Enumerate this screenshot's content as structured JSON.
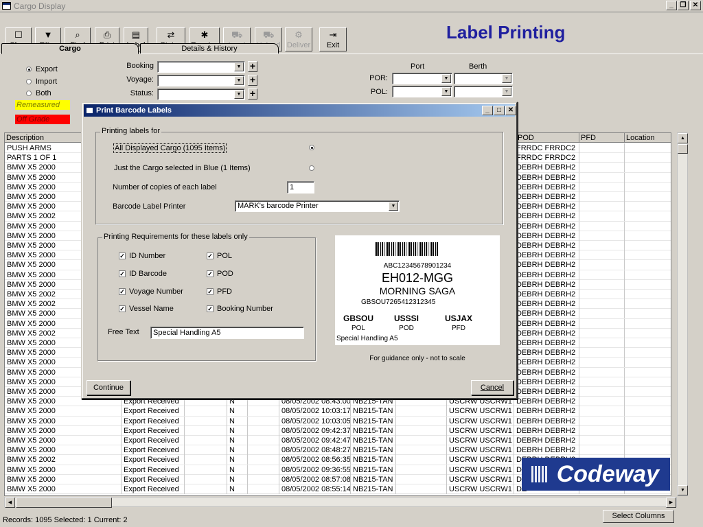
{
  "window": {
    "title": "Cargo Display"
  },
  "toolbar": [
    {
      "label": "Clear",
      "icon": "☐",
      "icon_name": "new-page-icon",
      "disabled": false
    },
    {
      "label": "Filter",
      "icon": "▼",
      "icon_name": "filter-funnel-icon",
      "disabled": false
    },
    {
      "label": "Find",
      "icon": "⌕",
      "icon_name": "magnifier-icon",
      "disabled": false
    },
    {
      "label": "Print",
      "icon": "⎙",
      "icon_name": "printer-icon",
      "disabled": false
    },
    {
      "label": "Label",
      "icon": "▤",
      "icon_name": "label-icon",
      "disabled": false
    },
    {
      "label": "Status",
      "icon": "⇄",
      "icon_name": "status-icon",
      "disabled": false
    },
    {
      "label": "Receive",
      "icon": "✱",
      "icon_name": "receive-icon",
      "disabled": false
    },
    {
      "label": "Load",
      "icon": "⛟",
      "icon_name": "load-icon",
      "disabled": true
    },
    {
      "label": "Unload",
      "icon": "⛟",
      "icon_name": "unload-icon",
      "disabled": true
    },
    {
      "label": "Deliver",
      "icon": "⚙",
      "icon_name": "deliver-icon",
      "disabled": true
    },
    {
      "label": "Exit",
      "icon": "⇥",
      "icon_name": "exit-door-icon",
      "disabled": false
    }
  ],
  "heading": "Label Printing",
  "tabs": [
    {
      "label": "Cargo"
    },
    {
      "label": "Details & History"
    }
  ],
  "filters": {
    "radios": [
      {
        "label": "Export",
        "checked": true
      },
      {
        "label": "Import",
        "checked": false
      },
      {
        "label": "Both",
        "checked": false
      }
    ],
    "booking_label": "Booking",
    "voyage_label": "Voyage:",
    "status_label": "Status:",
    "port_label": "Port",
    "berth_label": "Berth",
    "por_label": "POR:",
    "pol_label": "POL:",
    "tag_remeasured": "Remeasured",
    "tag_red": "Off Grade"
  },
  "grid": {
    "headers_visible": [
      "Description",
      "POD",
      "PFD",
      "Location"
    ],
    "rows": [
      {
        "desc": "PUSH ARMS",
        "pod": "FRRDC FRRDC2"
      },
      {
        "desc": "PARTS 1 OF 1",
        "pod": "FRRDC FRRDC2"
      },
      {
        "desc": "BMW X5 2000",
        "pod": "DEBRH DEBRH2"
      },
      {
        "desc": "BMW X5 2000",
        "pod": "DEBRH DEBRH2"
      },
      {
        "desc": "BMW X5 2000",
        "pod": "DEBRH DEBRH2"
      },
      {
        "desc": "BMW X5 2000",
        "pod": "DEBRH DEBRH2"
      },
      {
        "desc": "BMW X5 2000",
        "pod": "DEBRH DEBRH2"
      },
      {
        "desc": "BMW X5 2002",
        "pod": "DEBRH DEBRH2"
      },
      {
        "desc": "BMW X5 2000",
        "pod": "DEBRH DEBRH2"
      },
      {
        "desc": "BMW X5 2000",
        "pod": "DEBRH DEBRH2"
      },
      {
        "desc": "BMW X5 2000",
        "pod": "DEBRH DEBRH2"
      },
      {
        "desc": "BMW X5 2000",
        "pod": "DEBRH DEBRH2"
      },
      {
        "desc": "BMW X5 2000",
        "pod": "DEBRH DEBRH2"
      },
      {
        "desc": "BMW X5 2000",
        "pod": "DEBRH DEBRH2"
      },
      {
        "desc": "BMW X5 2000",
        "pod": "DEBRH DEBRH2"
      },
      {
        "desc": "BMW X5 2002",
        "pod": "DEBRH DEBRH2"
      },
      {
        "desc": "BMW X5 2002",
        "pod": "DEBRH DEBRH2"
      },
      {
        "desc": "BMW X5 2000",
        "pod": "DEBRH DEBRH2"
      },
      {
        "desc": "BMW X5 2000",
        "pod": "DEBRH DEBRH2"
      },
      {
        "desc": "BMW X5 2002",
        "pod": "DEBRH DEBRH2"
      },
      {
        "desc": "BMW X5 2000",
        "pod": "DEBRH DEBRH2"
      },
      {
        "desc": "BMW X5 2000",
        "pod": "DEBRH DEBRH2"
      },
      {
        "desc": "BMW X5 2000",
        "pod": "DEBRH DEBRH2"
      },
      {
        "desc": "BMW X5 2000",
        "pod": "DEBRH DEBRH2"
      },
      {
        "desc": "BMW X5 2000",
        "pod": "DEBRH DEBRH2"
      },
      {
        "desc": "BMW X5 2000",
        "pod": "DEBRH DEBRH2"
      },
      {
        "desc": "BMW X5 2000",
        "status": "Export Received",
        "n": "N",
        "date": "08/05/2002 08:43:00",
        "voy": "NB215-TAN",
        "por": "USCRW USCRW1",
        "pod": "DEBRH DEBRH2"
      },
      {
        "desc": "BMW X5 2000",
        "status": "Export Received",
        "n": "N",
        "date": "08/05/2002 10:03:17",
        "voy": "NB215-TAN",
        "por": "USCRW USCRW1",
        "pod": "DEBRH DEBRH2"
      },
      {
        "desc": "BMW X5 2000",
        "status": "Export Received",
        "n": "N",
        "date": "08/05/2002 10:03:05",
        "voy": "NB215-TAN",
        "por": "USCRW USCRW1",
        "pod": "DEBRH DEBRH2"
      },
      {
        "desc": "BMW X5 2000",
        "status": "Export Received",
        "n": "N",
        "date": "08/05/2002 09:42:37",
        "voy": "NB215-TAN",
        "por": "USCRW USCRW1",
        "pod": "DEBRH DEBRH2"
      },
      {
        "desc": "BMW X5 2000",
        "status": "Export Received",
        "n": "N",
        "date": "08/05/2002 09:42:47",
        "voy": "NB215-TAN",
        "por": "USCRW USCRW1",
        "pod": "DEBRH DEBRH2"
      },
      {
        "desc": "BMW X5 2000",
        "status": "Export Received",
        "n": "N",
        "date": "08/05/2002 08:48:27",
        "voy": "NB215-TAN",
        "por": "USCRW USCRW1",
        "pod": "DEBRH DEBRH2"
      },
      {
        "desc": "BMW X5 2002",
        "status": "Export Received",
        "n": "N",
        "date": "08/05/2002 08:56:35",
        "voy": "NB215-TAN",
        "por": "USCRW USCRW1",
        "pod": "DEBRH DEBRH2"
      },
      {
        "desc": "BMW X5 2000",
        "status": "Export Received",
        "n": "N",
        "date": "08/05/2002 09:36:55",
        "voy": "NB215-TAN",
        "por": "USCRW USCRW1",
        "pod": "DE"
      },
      {
        "desc": "BMW X5 2000",
        "status": "Export Received",
        "n": "N",
        "date": "08/05/2002 08:57:08",
        "voy": "NB215-TAN",
        "por": "USCRW USCRW1",
        "pod": "DE"
      },
      {
        "desc": "BMW X5 2000",
        "status": "Export Received",
        "n": "N",
        "date": "08/05/2002 08:55:14",
        "voy": "NB215-TAN",
        "por": "USCRW USCRW1",
        "pod": "DE"
      }
    ]
  },
  "status_bar": {
    "text": "Records: 1095  Selected: 1  Current: 2",
    "select_columns": "Select Columns"
  },
  "dialog": {
    "title": "Print Barcode Labels",
    "group1_legend": "Printing labels for",
    "opt_all": "All Displayed Cargo  (1095 Items)",
    "opt_selected": "Just the Cargo selected in Blue (1 Items)",
    "copies_label": "Number of copies of each label",
    "copies_value": "1",
    "printer_label": "Barcode Label Printer",
    "printer_value": "MARK's barcode Printer",
    "group2_legend": "Printing Requirements for these labels only",
    "checks": [
      {
        "label": "ID Number",
        "checked": true
      },
      {
        "label": "POL",
        "checked": true
      },
      {
        "label": "ID Barcode",
        "checked": true
      },
      {
        "label": "POD",
        "checked": true
      },
      {
        "label": "Voyage Number",
        "checked": true
      },
      {
        "label": "PFD",
        "checked": true
      },
      {
        "label": "Vessel Name",
        "checked": true
      },
      {
        "label": "Booking Number",
        "checked": true
      }
    ],
    "free_text_label": "Free Text",
    "free_text_value": "Special Handling A5",
    "preview": {
      "barcode_text": "ABC12345678901234",
      "line1": "EH012-MGG",
      "line2": "MORNING SAGA",
      "booking": "GBSOU7265412312345",
      "ports": [
        "GBSOU",
        "USSSI",
        "USJAX"
      ],
      "port_labels": [
        "POL",
        "POD",
        "PFD"
      ],
      "free_text": "Special Handling A5"
    },
    "guidance": "For guidance only - not to scale",
    "continue_label": "Continue",
    "cancel_label": "Cancel"
  },
  "logo": {
    "text": "Codeway"
  }
}
